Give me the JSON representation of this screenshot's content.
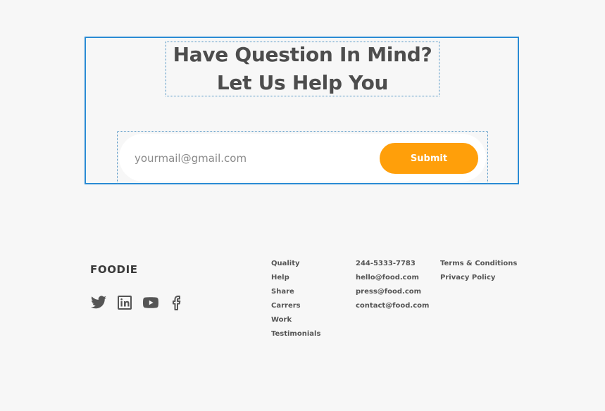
{
  "newsletter": {
    "heading_line_1": "Have Question In Mind?",
    "heading_line_2": "Let Us Help You",
    "email_placeholder": "yourmail@gmail.com",
    "submit_label": "Submit"
  },
  "footer": {
    "logo": "FOODIE",
    "social": [
      {
        "icon": "twitter-icon"
      },
      {
        "icon": "linkedin-icon"
      },
      {
        "icon": "youtube-icon"
      },
      {
        "icon": "facebook-icon"
      }
    ],
    "links_column_1": [
      "Quality",
      "Help",
      "Share",
      "Carrers",
      "Work",
      "Testimonials"
    ],
    "contact_column": [
      "244-5333-7783",
      "hello@food.com",
      "press@food.com",
      "contact@food.com"
    ],
    "legal_column": [
      "Terms & Conditions",
      "Privacy Policy"
    ]
  },
  "colors": {
    "background": "#f7f7f7",
    "accent": "#ff9f0a",
    "selection_border": "#2a8bd4",
    "text": "#4d4d4d"
  }
}
